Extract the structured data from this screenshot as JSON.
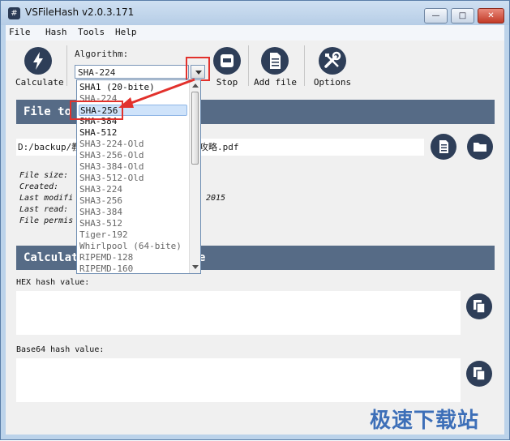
{
  "window": {
    "title": "VSFileHash v2.0.3.171"
  },
  "menu": [
    "File",
    "Hash",
    "Tools",
    "Help"
  ],
  "toolbar": {
    "calculate": "Calculate",
    "algorithm_label": "Algorithm:",
    "algorithm_value": "SHA-224",
    "stop": "Stop",
    "add_file": "Add file",
    "options": "Options"
  },
  "file_section": {
    "title_prefix": "File to",
    "path_prefix": "D:/backup/教",
    "path_suffix": "攻略.pdf",
    "info": [
      {
        "prefix": "File size: ",
        "tail": ""
      },
      {
        "prefix": "Created: ",
        "tail": ""
      },
      {
        "prefix": "Last modifi",
        "tail": "2015"
      },
      {
        "prefix": "Last read: ",
        "tail": ""
      },
      {
        "prefix": "File permis",
        "tail": ""
      }
    ]
  },
  "calc_section": {
    "title_prefix": "Calculat",
    "title_suffix": "e"
  },
  "hash": {
    "hex_label": "HEX hash value:",
    "base64_label": "Base64 hash value:"
  },
  "dropdown": {
    "items": [
      "SHA1 (20-bite)",
      "SHA-224",
      "SHA-256",
      "SHA-384",
      "SHA-512",
      "SHA3-224-Old",
      "SHA3-256-Old",
      "SHA3-384-Old",
      "SHA3-512-Old",
      "SHA3-224",
      "SHA3-256",
      "SHA3-384",
      "SHA3-512",
      "Tiger-192",
      "Whirlpool (64-bite)",
      "RIPEMD-128",
      "RIPEMD-160"
    ],
    "selected_index": 2
  },
  "watermark": "极速下载站",
  "colors": {
    "accent_red": "#e2312c",
    "section_bar": "#566b86",
    "icon_dark": "#2e3e58"
  }
}
